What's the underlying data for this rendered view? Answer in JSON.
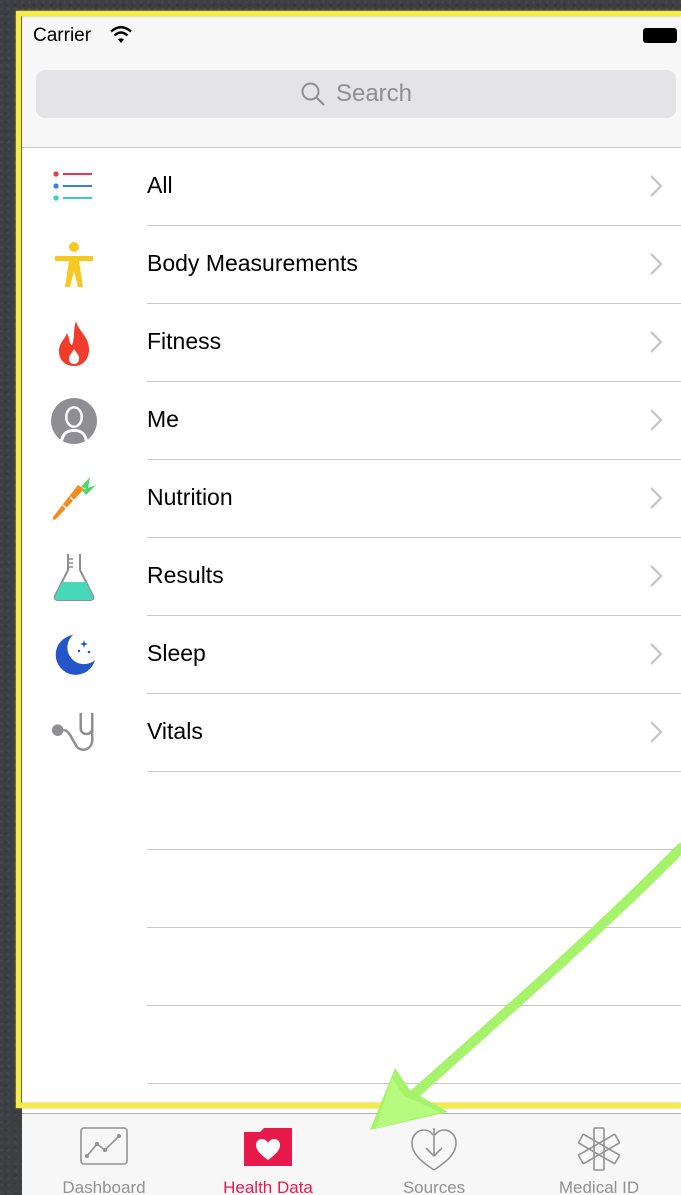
{
  "status_bar": {
    "carrier": "Carrier"
  },
  "search": {
    "placeholder": "Search"
  },
  "categories": [
    {
      "label": "All",
      "icon": "list-icon"
    },
    {
      "label": "Body Measurements",
      "icon": "body-figure-icon"
    },
    {
      "label": "Fitness",
      "icon": "flame-icon"
    },
    {
      "label": "Me",
      "icon": "person-icon"
    },
    {
      "label": "Nutrition",
      "icon": "carrot-icon"
    },
    {
      "label": "Results",
      "icon": "flask-icon"
    },
    {
      "label": "Sleep",
      "icon": "moon-icon"
    },
    {
      "label": "Vitals",
      "icon": "stethoscope-icon"
    }
  ],
  "tabs": [
    {
      "label": "Dashboard",
      "icon": "chart-icon",
      "active": false
    },
    {
      "label": "Health Data",
      "icon": "heart-folder-icon",
      "active": true
    },
    {
      "label": "Sources",
      "icon": "download-heart-icon",
      "active": false
    },
    {
      "label": "Medical ID",
      "icon": "asterisk-icon",
      "active": false
    }
  ],
  "colors": {
    "accent": "#e8194b",
    "highlight_outline": "#f4ec4a",
    "annotation_arrow": "#a6f36b",
    "separator": "#c8c7cc"
  }
}
